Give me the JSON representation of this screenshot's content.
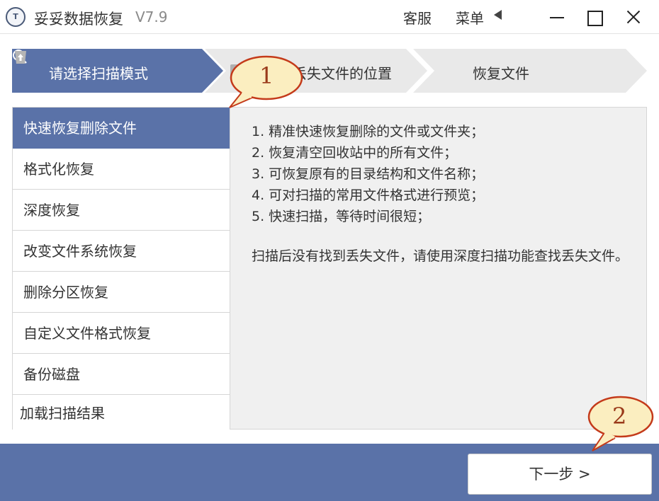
{
  "titlebar": {
    "logo_text": "T",
    "title": "妥妥数据恢复",
    "version": "V7.9",
    "service_label": "客服",
    "menu_label": "菜单"
  },
  "steps": {
    "step1": "请选择扫描模式",
    "step2": "丢失文件的位置",
    "step3": "恢复文件"
  },
  "modes": [
    "快速恢复删除文件",
    "格式化恢复",
    "深度恢复",
    "改变文件系统恢复",
    "删除分区恢复",
    "自定义文件格式恢复",
    "备份磁盘",
    "加载扫描结果"
  ],
  "description": {
    "lines": [
      "1. 精准快速恢复删除的文件或文件夹；",
      "2. 恢复清空回收站中的所有文件；",
      "3. 可恢复原有的目录结构和文件名称；",
      "4. 可对扫描的常用文件格式进行预览；",
      "5. 快速扫描，等待时间很短；"
    ],
    "note": "扫描后没有找到丢失文件，请使用深度扫描功能查找丢失文件。"
  },
  "footer": {
    "next_label": "下一步 >"
  },
  "callouts": {
    "c1": "1",
    "c2": "2"
  },
  "colors": {
    "accent": "#5a72a8",
    "panel": "#f0f0f0",
    "callout_fill": "#fbeec0",
    "callout_border": "#c43a1a"
  }
}
